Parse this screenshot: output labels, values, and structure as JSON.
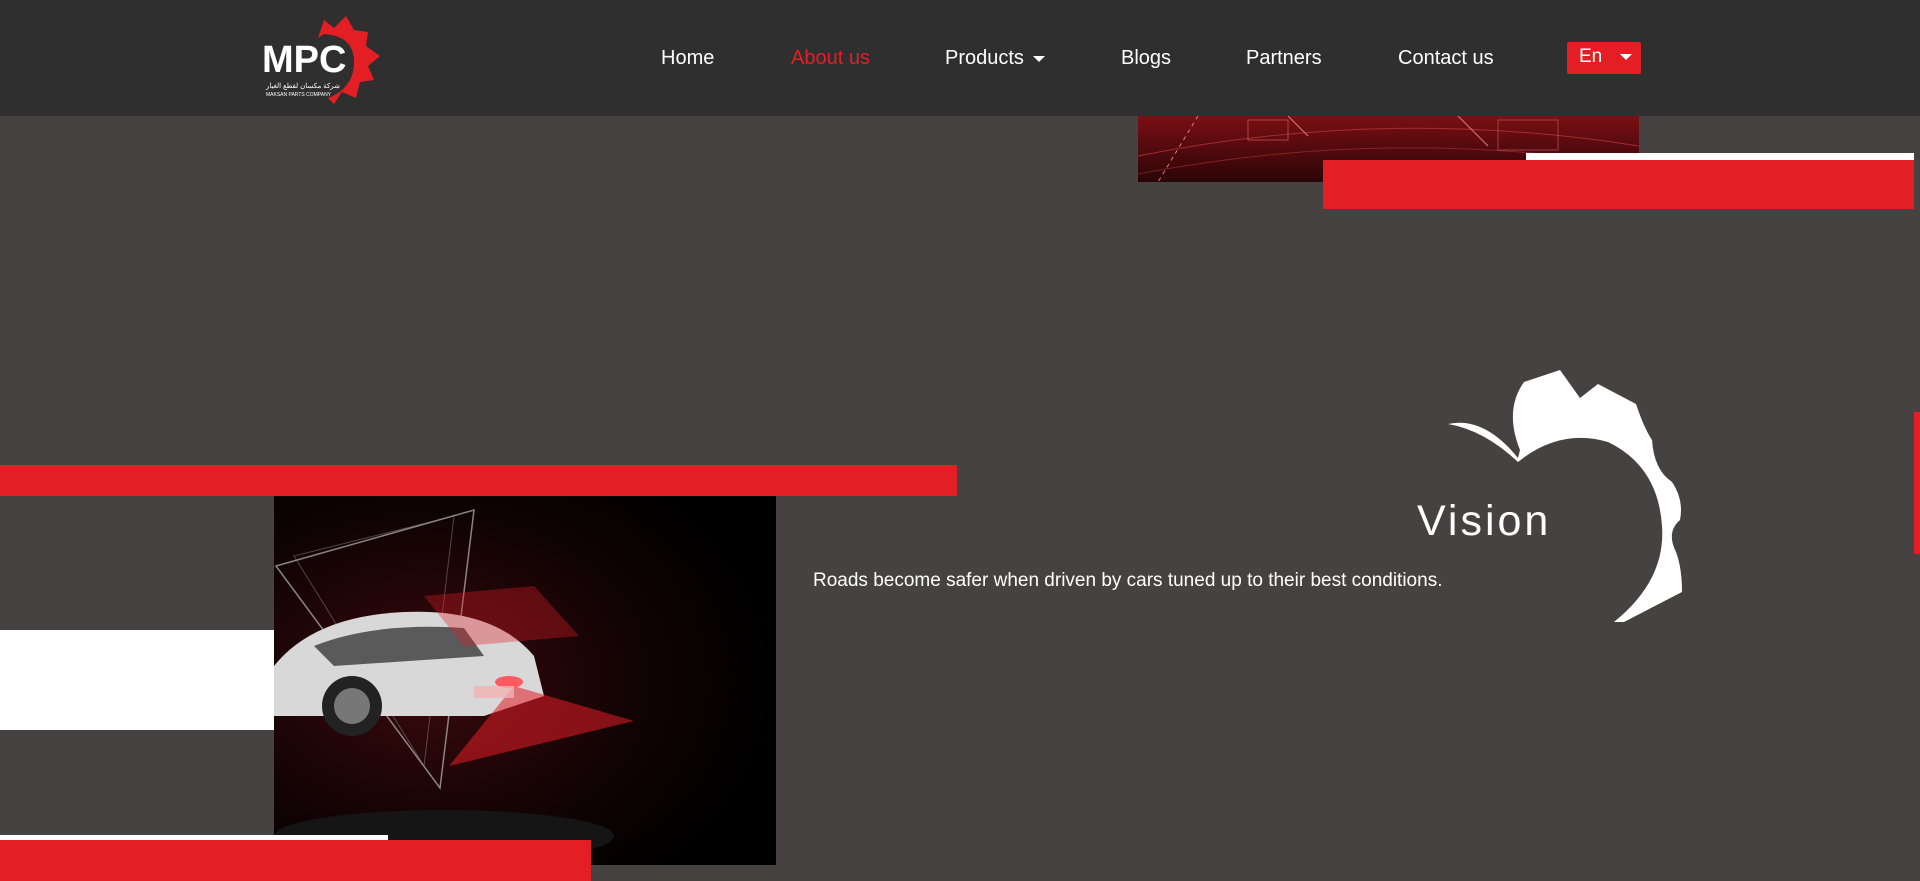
{
  "brand": {
    "logo_text": "MPC",
    "logo_subtitle_ar": "شركة مكسان لقطع الغيار",
    "logo_subtitle_en": "MAKSAN PARTS COMPANY",
    "primary_color": "#e31e24",
    "nav_background": "#2f2f2f",
    "page_background": "#464242"
  },
  "nav": {
    "items": [
      {
        "label": "Home",
        "active": false
      },
      {
        "label": "About us",
        "active": true
      },
      {
        "label": "Products",
        "active": false,
        "has_dropdown": true
      },
      {
        "label": "Blogs",
        "active": false
      },
      {
        "label": "Partners",
        "active": false
      },
      {
        "label": "Contact us",
        "active": false
      }
    ],
    "language": {
      "label": "En",
      "icon": "chevron-down-icon"
    }
  },
  "vision": {
    "title": "Vision",
    "text": "Roads become safer when driven by cars tuned up to their best conditions.",
    "decoration_icon": "gear-arc-icon"
  },
  "images": {
    "top": "red-hud-grid-image",
    "vision": "futuristic-white-car-with-red-lasers-image"
  }
}
